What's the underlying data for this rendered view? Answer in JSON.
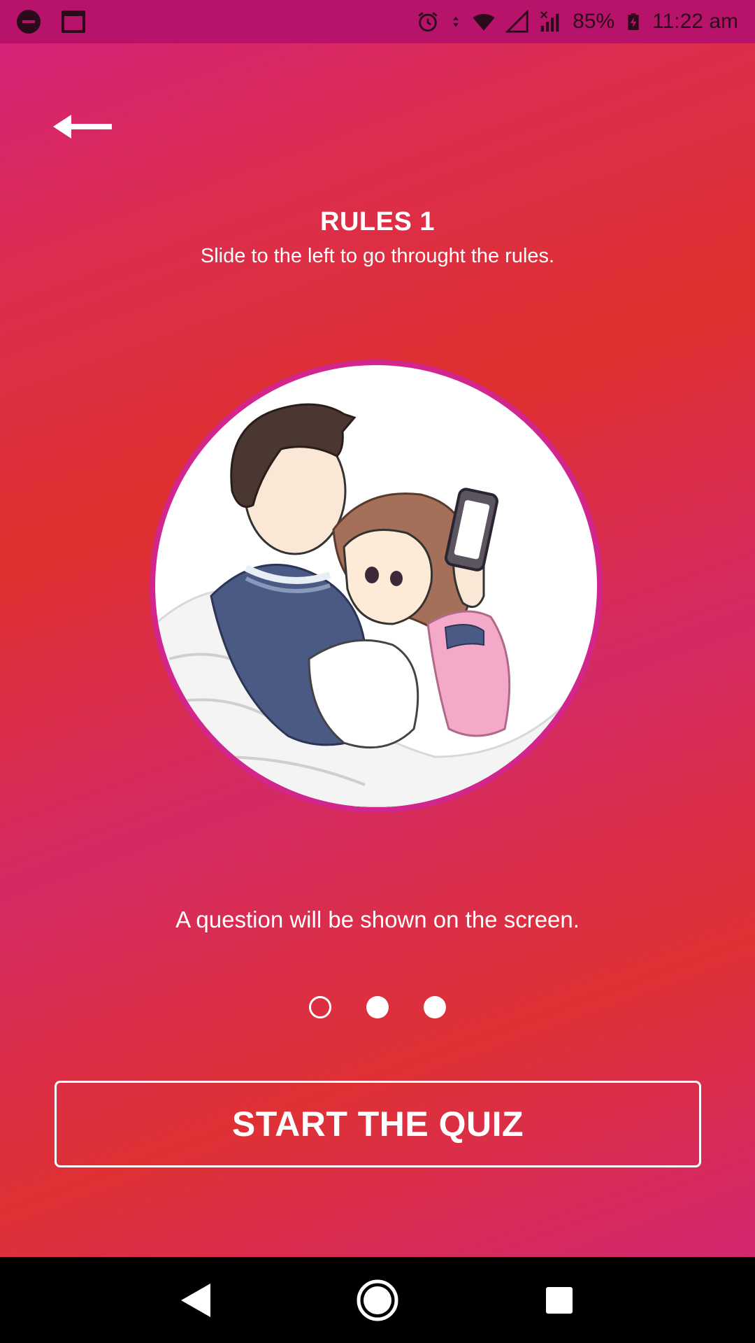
{
  "status_bar": {
    "battery": "85%",
    "time": "11:22 am",
    "icons": [
      "do-not-disturb-icon",
      "calendar-icon",
      "alarm-icon",
      "data-arrows-icon",
      "wifi-icon",
      "signal-icon",
      "no-signal-icon",
      "battery-charging-icon"
    ]
  },
  "header": {
    "back_icon": "arrow-left-icon",
    "title": "RULES 1",
    "subtitle": "Slide to the left to go throught the rules."
  },
  "illustration": {
    "description_icon": "couple-illustration"
  },
  "main": {
    "description": "A question will be shown on the screen."
  },
  "pager": {
    "current_page": 1,
    "total_pages": 3
  },
  "cta": {
    "label": "START THE QUIZ"
  },
  "nav_bar": {
    "icons": [
      "back-triangle-icon",
      "home-circle-icon",
      "recents-square-icon"
    ]
  },
  "colors": {
    "accent_pink": "#d3268c",
    "status_bar": "#b8136a",
    "gradient_red": "#e0302f"
  }
}
